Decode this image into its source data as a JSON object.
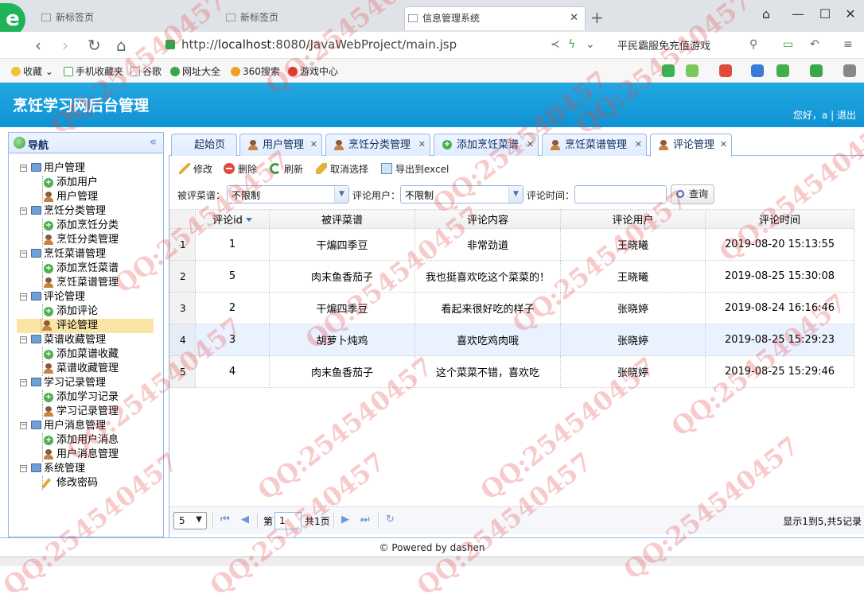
{
  "browser": {
    "tabs": [
      {
        "label": "新标签页"
      },
      {
        "label": "新标签页"
      },
      {
        "label": "信息管理系统"
      }
    ],
    "url_prefix": "http://",
    "url_host": "localhost",
    "url_rest": ":8080/JavaWebProject/main.jsp",
    "search_hint": "平民霸服免充值游戏",
    "bookmarks": [
      {
        "label": "收藏",
        "icon": "star-icon"
      },
      {
        "label": "手机收藏夹",
        "icon": "phone-icon"
      },
      {
        "label": "谷歌",
        "icon": "page-icon"
      },
      {
        "label": "网址大全",
        "icon": "globe-icon"
      },
      {
        "label": "360搜索",
        "icon": "search-icon"
      },
      {
        "label": "游戏中心",
        "icon": "game-icon"
      }
    ]
  },
  "app": {
    "title": "烹饪学习网后台管理",
    "greeting": "您好，a",
    "separator": "|",
    "logout": "退出"
  },
  "sidebar": {
    "title": "导航",
    "collapse_icon": "«",
    "groups": [
      {
        "label": "用户管理",
        "items": [
          {
            "label": "添加用户",
            "icon": "add"
          },
          {
            "label": "用户管理",
            "icon": "user"
          }
        ]
      },
      {
        "label": "烹饪分类管理",
        "items": [
          {
            "label": "添加烹饪分类",
            "icon": "add"
          },
          {
            "label": "烹饪分类管理",
            "icon": "user"
          }
        ]
      },
      {
        "label": "烹饪菜谱管理",
        "items": [
          {
            "label": "添加烹饪菜谱",
            "icon": "add"
          },
          {
            "label": "烹饪菜谱管理",
            "icon": "user"
          }
        ]
      },
      {
        "label": "评论管理",
        "items": [
          {
            "label": "添加评论",
            "icon": "add"
          },
          {
            "label": "评论管理",
            "icon": "user",
            "selected": true
          }
        ]
      },
      {
        "label": "菜谱收藏管理",
        "items": [
          {
            "label": "添加菜谱收藏",
            "icon": "add"
          },
          {
            "label": "菜谱收藏管理",
            "icon": "user"
          }
        ]
      },
      {
        "label": "学习记录管理",
        "items": [
          {
            "label": "添加学习记录",
            "icon": "add"
          },
          {
            "label": "学习记录管理",
            "icon": "user"
          }
        ]
      },
      {
        "label": "用户消息管理",
        "items": [
          {
            "label": "添加用户消息",
            "icon": "add"
          },
          {
            "label": "用户消息管理",
            "icon": "user"
          }
        ]
      },
      {
        "label": "系统管理",
        "items": [
          {
            "label": "修改密码",
            "icon": "pen"
          }
        ]
      }
    ]
  },
  "page_tabs": [
    {
      "label": "起始页",
      "icon": "none",
      "closable": false
    },
    {
      "label": "用户管理",
      "icon": "user",
      "closable": true
    },
    {
      "label": "烹饪分类管理",
      "icon": "user",
      "closable": true
    },
    {
      "label": "添加烹饪菜谱",
      "icon": "add",
      "closable": true
    },
    {
      "label": "烹饪菜谱管理",
      "icon": "user",
      "closable": true
    },
    {
      "label": "评论管理",
      "icon": "user",
      "closable": true,
      "active": true
    }
  ],
  "toolbar": {
    "edit": "修改",
    "delete": "删除",
    "refresh": "刷新",
    "cancel_select": "取消选择",
    "export": "导出到excel"
  },
  "filters": {
    "recipe_label": "被评菜谱：",
    "recipe_value": "不限制",
    "user_label": "评论用户：",
    "user_value": "不限制",
    "time_label": "评论时间：",
    "time_value": "",
    "query_button": "查询"
  },
  "grid": {
    "columns": [
      "评论id",
      "被评菜谱",
      "评论内容",
      "评论用户",
      "评论时间"
    ],
    "rows": [
      {
        "rownum": "1",
        "id": "1",
        "recipe": "干煸四季豆",
        "content": "非常劲道",
        "user": "王晓曦",
        "time": "2019-08-20 15:13:55"
      },
      {
        "rownum": "2",
        "id": "5",
        "recipe": "肉末鱼香茄子",
        "content": "我也挺喜欢吃这个菜菜的！",
        "user": "王晓曦",
        "time": "2019-08-25 15:30:08"
      },
      {
        "rownum": "3",
        "id": "2",
        "recipe": "干煸四季豆",
        "content": "看起来很好吃的样子",
        "user": "张晓婷",
        "time": "2019-08-24 16:16:46"
      },
      {
        "rownum": "4",
        "id": "3",
        "recipe": "胡萝卜炖鸡",
        "content": "喜欢吃鸡肉哦",
        "user": "张晓婷",
        "time": "2019-08-25 15:29:23"
      },
      {
        "rownum": "5",
        "id": "4",
        "recipe": "肉末鱼香茄子",
        "content": "这个菜菜不错，喜欢吃",
        "user": "张晓婷",
        "time": "2019-08-25 15:29:46"
      }
    ]
  },
  "pager": {
    "page_size": "5",
    "page_prefix": "第",
    "page_number": "1",
    "page_total": "共1页",
    "info": "显示1到5,共5记录"
  },
  "footer": "© Powered by dashen",
  "watermark": "QQ:254540457"
}
